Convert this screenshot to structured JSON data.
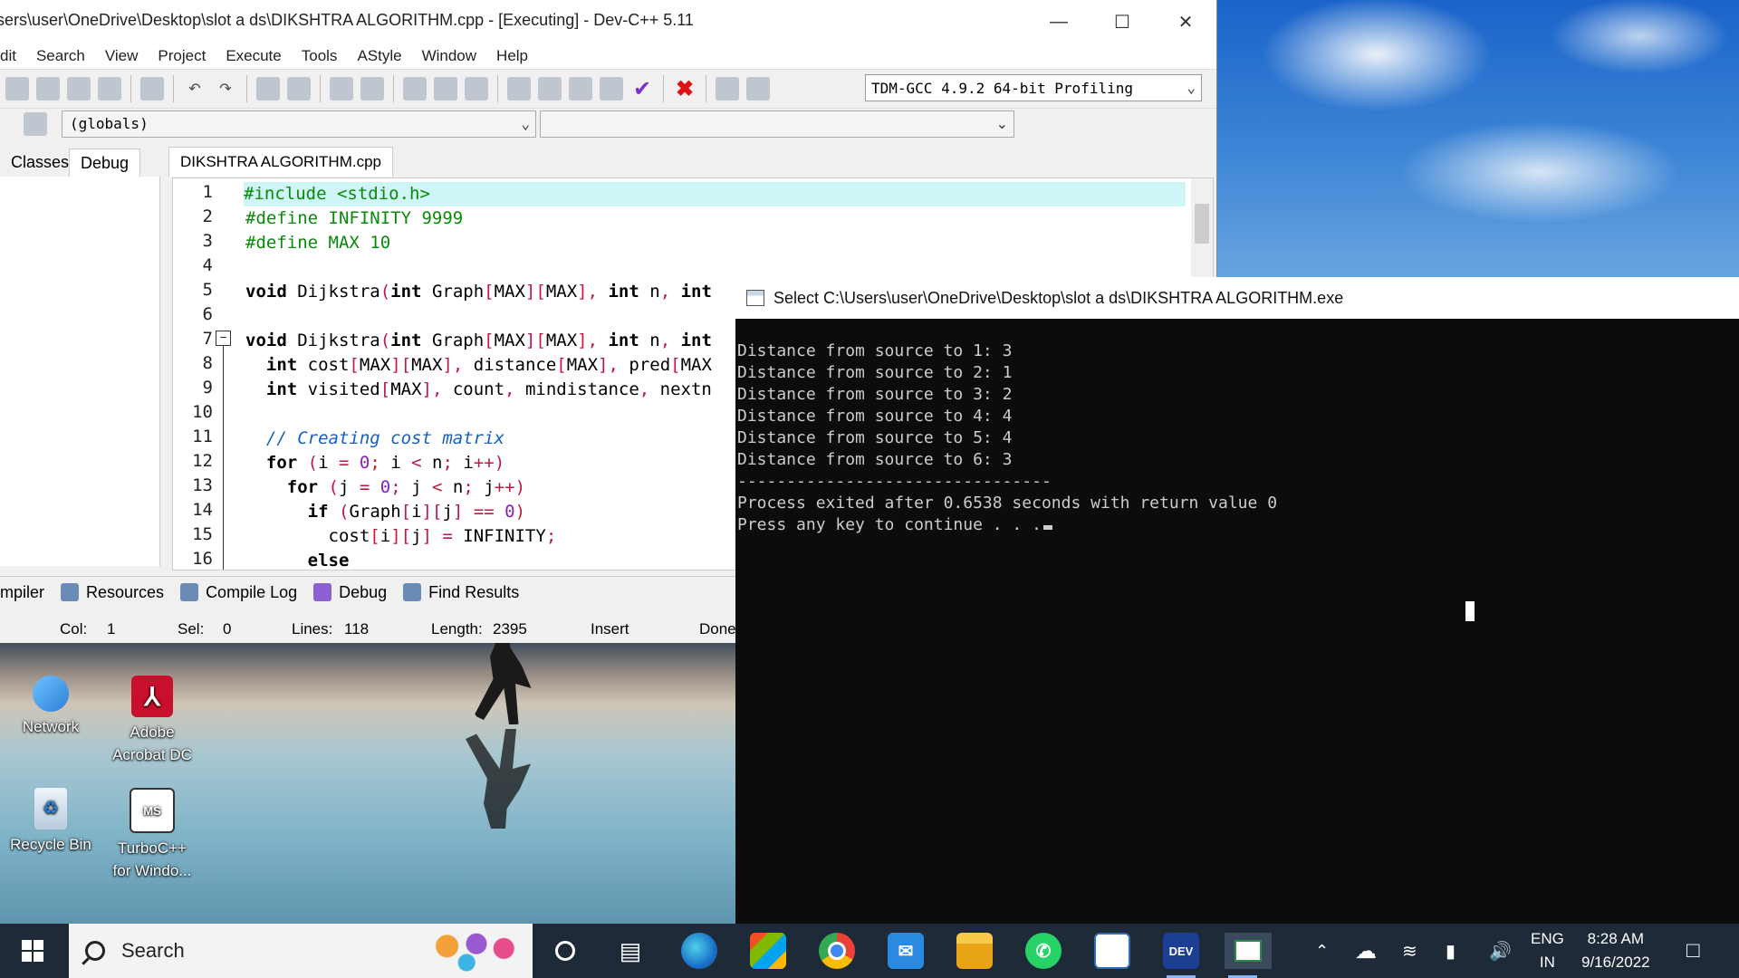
{
  "ide": {
    "title": "sers\\user\\OneDrive\\Desktop\\slot a ds\\DIKSHTRA ALGORITHM.cpp - [Executing] - Dev-C++ 5.11",
    "menu": [
      "dit",
      "Search",
      "View",
      "Project",
      "Execute",
      "Tools",
      "AStyle",
      "Window",
      "Help"
    ],
    "compiler": "TDM-GCC 4.9.2 64-bit Profiling",
    "scope": "(globals)",
    "left_tabs": [
      "Classes",
      "Debug"
    ],
    "file_tab": "DIKSHTRA ALGORITHM.cpp",
    "line_numbers": [
      "1",
      "2",
      "3",
      "4",
      "5",
      "6",
      "7",
      "8",
      "9",
      "10",
      "11",
      "12",
      "13",
      "14",
      "15",
      "16"
    ],
    "bottom_tabs": [
      "mpiler",
      "Resources",
      "Compile Log",
      "Debug",
      "Find Results"
    ],
    "status": {
      "col_label": "Col:",
      "col": "1",
      "sel_label": "Sel:",
      "sel": "0",
      "lines_label": "Lines:",
      "lines": "118",
      "length_label": "Length:",
      "length": "2395",
      "mode": "Insert",
      "state": "Done"
    }
  },
  "code": {
    "l1": "#include <stdio.h>",
    "l2": "#define INFINITY 9999",
    "l3": "#define MAX 10",
    "l11": "// Creating cost matrix"
  },
  "console": {
    "title": "Select C:\\Users\\user\\OneDrive\\Desktop\\slot a ds\\DIKSHTRA ALGORITHM.exe",
    "lines": [
      "Distance from source to 1: 3",
      "Distance from source to 2: 1",
      "Distance from source to 3: 2",
      "Distance from source to 4: 4",
      "Distance from source to 5: 4",
      "Distance from source to 6: 3",
      "--------------------------------",
      "Process exited after 0.6538 seconds with return value 0",
      "Press any key to continue . . ."
    ]
  },
  "desktop_icons": [
    {
      "label": "Network",
      "icon": "network-icon"
    },
    {
      "label": "Adobe\nAcrobat DC",
      "icon": "acrobat-icon"
    },
    {
      "label": "Recycle Bin",
      "icon": "recycle-bin-icon"
    },
    {
      "label": "TurboC++\nfor Windo...",
      "icon": "turbo-cpp-icon"
    }
  ],
  "taskbar": {
    "search_label": "Search",
    "lang_line1": "ENG",
    "lang_line2": "IN",
    "time": "8:28 AM",
    "date": "9/16/2022"
  }
}
